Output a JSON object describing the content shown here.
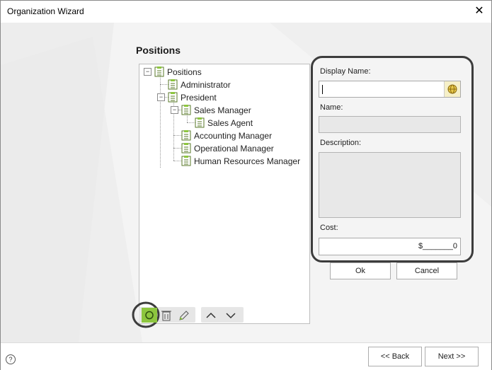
{
  "window": {
    "title": "Organization Wizard",
    "close_glyph": "✕"
  },
  "page": {
    "heading": "Positions"
  },
  "tree": {
    "nodes": [
      {
        "label": "Positions",
        "icon": "document-list-icon"
      },
      {
        "label": "Administrator",
        "icon": "document-list-icon"
      },
      {
        "label": "President",
        "icon": "document-list-icon"
      },
      {
        "label": "Sales Manager",
        "icon": "document-list-icon"
      },
      {
        "label": "Sales Agent",
        "icon": "document-list-icon"
      },
      {
        "label": "Accounting Manager",
        "icon": "document-list-icon"
      },
      {
        "label": "Operational Manager",
        "icon": "document-list-icon"
      },
      {
        "label": "Human Resources Manager",
        "icon": "document-list-icon"
      }
    ],
    "collapse_glyph": "−"
  },
  "toolbar": {
    "icons": [
      "add-icon",
      "delete-icon",
      "edit-icon",
      "move-up-icon",
      "move-down-icon"
    ]
  },
  "form": {
    "display_name_label": "Display Name:",
    "display_name_value": "",
    "name_label": "Name:",
    "name_value": "",
    "description_label": "Description:",
    "description_value": "",
    "cost_label": "Cost:",
    "cost_value": "$_______0",
    "ok_label": "Ok",
    "cancel_label": "Cancel"
  },
  "footer": {
    "help_glyph": "?",
    "back_label": "<< Back",
    "next_label": "Next >>"
  },
  "colors": {
    "accent_green": "#8dc63f",
    "highlight_ring": "#3c3c3c"
  }
}
